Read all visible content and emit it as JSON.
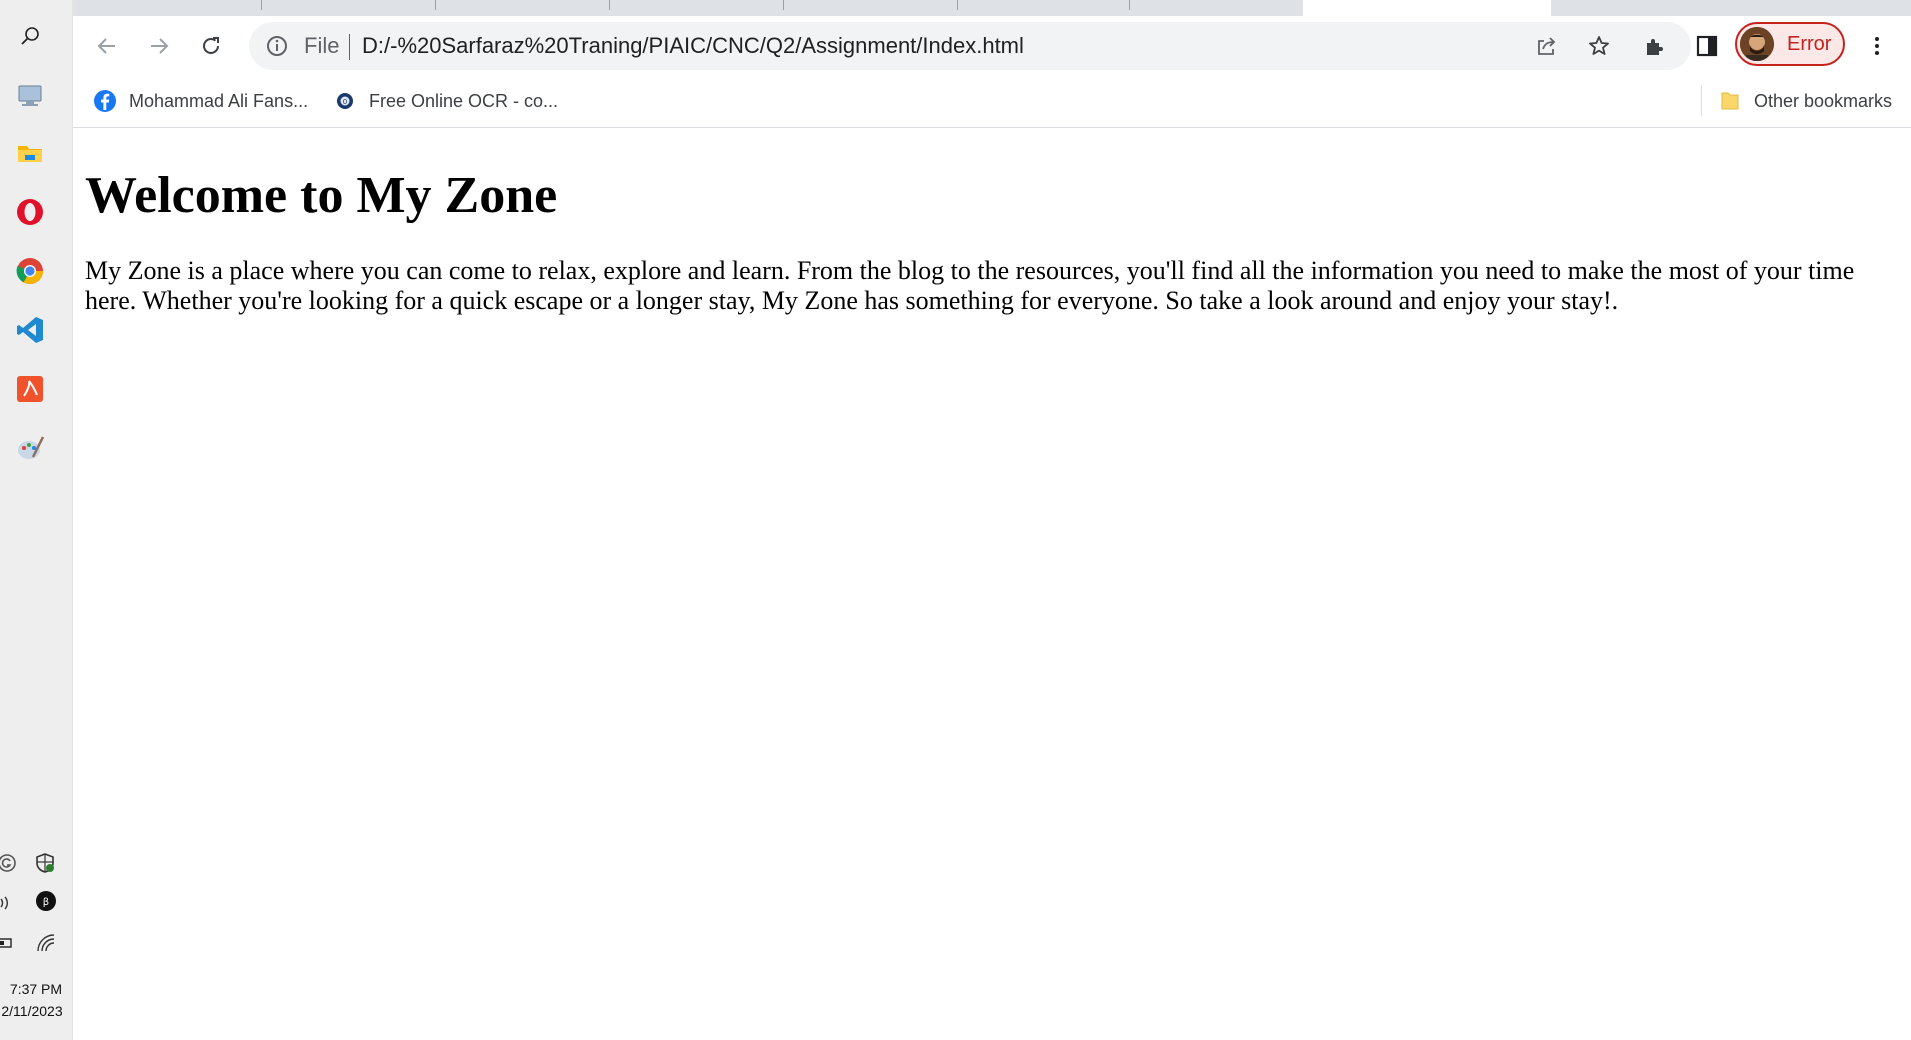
{
  "taskbar": {
    "icons": [
      "search-icon",
      "remote-desktop-icon",
      "file-explorer-icon",
      "opera-icon",
      "chrome-icon",
      "vscode-icon",
      "acrobat-icon",
      "paint-icon"
    ],
    "tray_icons": [
      "grammarly-icon",
      "defender-icon",
      "volume-icon",
      "app-tray-icon",
      "battery-icon",
      "wifi-icon"
    ],
    "time": "7:37 PM",
    "date": "2/11/2023"
  },
  "toolbar": {
    "omnibox_scheme": "File",
    "url": "D:/-%20Sarfaraz%20Traning/PIAIC/CNC/Q2/Assignment/Index.html",
    "profile_label": "Error"
  },
  "bookmarks": {
    "items": [
      {
        "label": "Mohammad Ali Fans...",
        "icon": "facebook-icon"
      },
      {
        "label": "Free Online OCR - co...",
        "icon": "ocr-icon"
      }
    ],
    "other_label": "Other bookmarks"
  },
  "page": {
    "heading": "Welcome to My Zone",
    "paragraph": "My Zone is a place where you can come to relax, explore and learn. From the blog to the resources, you'll find all the information you need to make the most of your time here. Whether you're looking for a quick escape or a longer stay, My Zone has something for everyone. So take a look around and enjoy your stay!."
  },
  "colors": {
    "accent_error": "#c5221f",
    "omnibox_bg": "#f1f3f4",
    "taskbar_bg": "#eeeeee"
  }
}
